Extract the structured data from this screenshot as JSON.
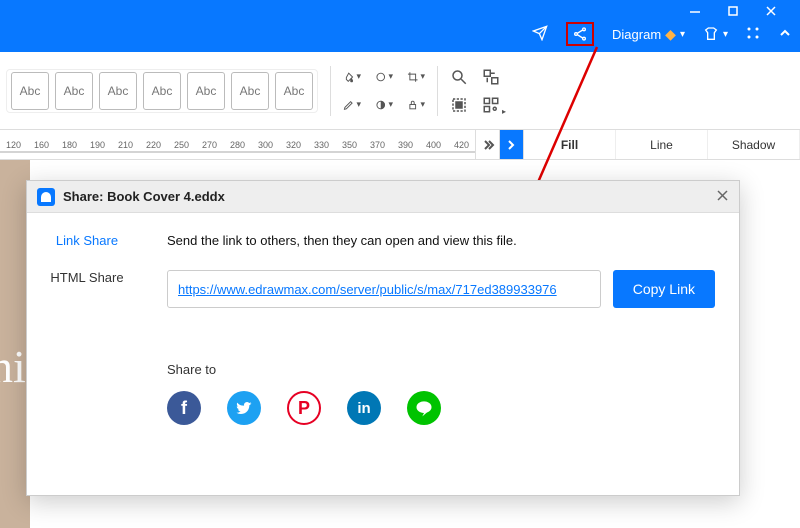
{
  "window": {
    "minimize": "—",
    "maximize": "☐",
    "close": "✕"
  },
  "topmenu": {
    "diagram_label": "Diagram"
  },
  "toolbar": {
    "abc_label": "Abc",
    "abc_count": 7
  },
  "ruler": {
    "ticks": [
      "120",
      "160",
      "180",
      "190",
      "210",
      "220",
      "250",
      "270",
      "280",
      "300",
      "320",
      "330",
      "350",
      "370",
      "390",
      "400",
      "420"
    ]
  },
  "tabs": {
    "fill": "Fill",
    "line": "Line",
    "shadow": "Shadow"
  },
  "canvas": {
    "book_text": "ni"
  },
  "modal": {
    "title": "Share: Book Cover 4.eddx",
    "close": "✕",
    "sidebar": {
      "link_share": "Link Share",
      "html_share": "HTML Share"
    },
    "help_text": "Send the link to others, then they can open and view this file.",
    "link_url": "https://www.edrawmax.com/server/public/s/max/717ed389933976",
    "copy_button": "Copy Link",
    "share_to_label": "Share to",
    "social": {
      "facebook": "f",
      "twitter": "tw",
      "pinterest": "P",
      "linkedin": "in",
      "line": "ln"
    }
  }
}
